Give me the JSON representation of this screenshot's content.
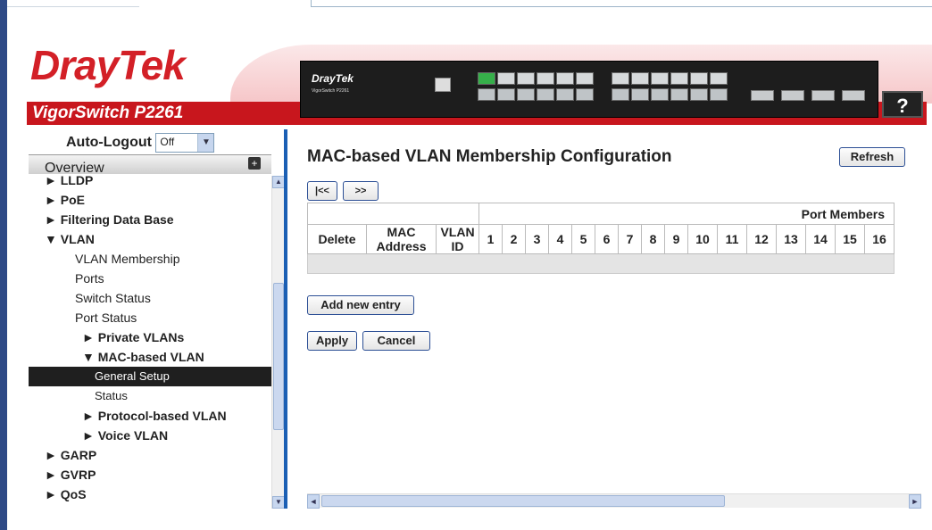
{
  "header": {
    "logo_text": "DrayTek",
    "model_name": "VigorSwitch P2261",
    "device_brand": "DrayTek",
    "device_model": "VigorSwitch P2261",
    "help_label": "?"
  },
  "sidebar": {
    "autologout_label": "Auto-Logout",
    "autologout_value": "Off",
    "overview_label": "Overview",
    "items": [
      {
        "label": "► LLDP",
        "level": 0
      },
      {
        "label": "► PoE",
        "level": 0
      },
      {
        "label": "► Filtering Data Base",
        "level": 0
      },
      {
        "label": "▼ VLAN",
        "level": 0
      },
      {
        "label": "VLAN Membership",
        "level": 1
      },
      {
        "label": "Ports",
        "level": 1
      },
      {
        "label": "Switch Status",
        "level": 1
      },
      {
        "label": "Port Status",
        "level": 1
      },
      {
        "label": "► Private VLANs",
        "level": 2
      },
      {
        "label": "▼ MAC-based VLAN",
        "level": 2
      },
      {
        "label": "General Setup",
        "level": 3
      },
      {
        "label": "Status",
        "level": 3
      },
      {
        "label": "► Protocol-based VLAN",
        "level": 2
      },
      {
        "label": "► Voice VLAN",
        "level": 2
      },
      {
        "label": "► GARP",
        "level": 0
      },
      {
        "label": "► GVRP",
        "level": 0
      },
      {
        "label": "► QoS",
        "level": 0
      }
    ]
  },
  "main": {
    "title": "MAC-based VLAN Membership Configuration",
    "refresh_label": "Refresh",
    "first_label": "|<<",
    "next_label": ">>",
    "table": {
      "group_header": "Port Members",
      "col_delete": "Delete",
      "col_mac": "MAC Address",
      "col_vlan": "VLAN ID",
      "ports": [
        "1",
        "2",
        "3",
        "4",
        "5",
        "6",
        "7",
        "8",
        "9",
        "10",
        "11",
        "12",
        "13",
        "14",
        "15",
        "16"
      ]
    },
    "add_entry_label": "Add new entry",
    "apply_label": "Apply",
    "cancel_label": "Cancel"
  }
}
